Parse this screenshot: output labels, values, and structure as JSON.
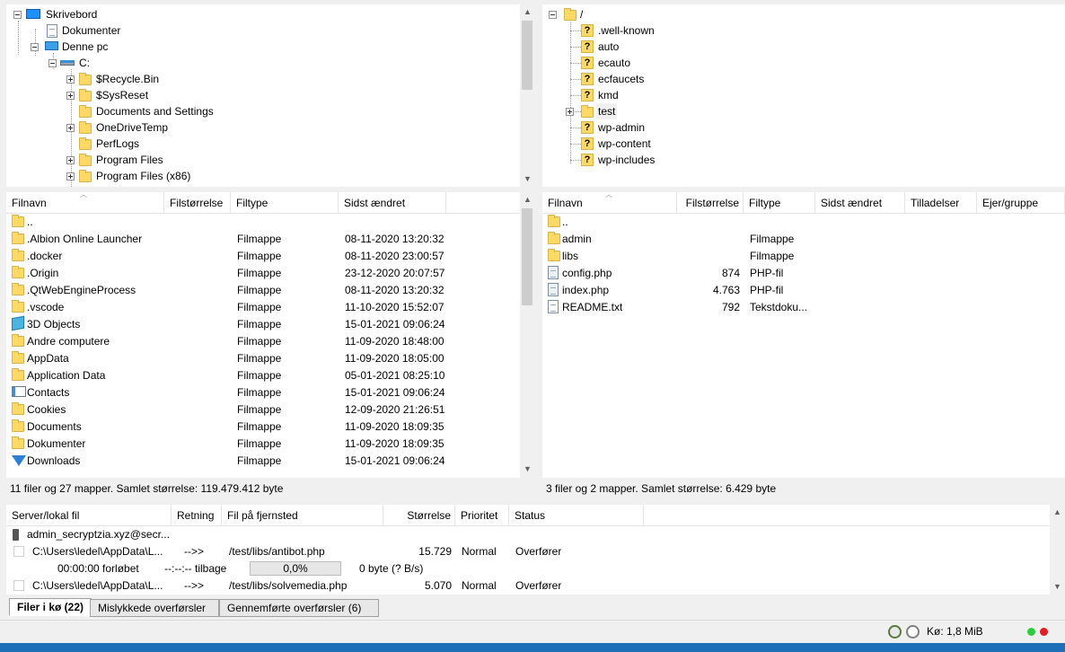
{
  "local_tree": {
    "items": [
      {
        "label": "Skrivebord",
        "icon": "desktop-icon"
      },
      {
        "label": "Dokumenter",
        "icon": "document-icon"
      },
      {
        "label": "Denne pc",
        "icon": "computer-icon"
      },
      {
        "label": "C:",
        "icon": "drive-icon"
      },
      {
        "label": "$Recycle.Bin",
        "icon": "folder-icon"
      },
      {
        "label": "$SysReset",
        "icon": "folder-icon"
      },
      {
        "label": "Documents and Settings",
        "icon": "folder-icon"
      },
      {
        "label": "OneDriveTemp",
        "icon": "folder-icon"
      },
      {
        "label": "PerfLogs",
        "icon": "folder-icon"
      },
      {
        "label": "Program Files",
        "icon": "folder-icon"
      },
      {
        "label": "Program Files (x86)",
        "icon": "folder-icon"
      }
    ]
  },
  "remote_tree": {
    "items": [
      {
        "label": "/",
        "icon": "folder-icon"
      },
      {
        "label": ".well-known",
        "icon": "unknown-folder-icon"
      },
      {
        "label": "auto",
        "icon": "unknown-folder-icon"
      },
      {
        "label": "ecauto",
        "icon": "unknown-folder-icon"
      },
      {
        "label": "ecfaucets",
        "icon": "unknown-folder-icon"
      },
      {
        "label": "kmd",
        "icon": "unknown-folder-icon"
      },
      {
        "label": "test",
        "icon": "folder-icon"
      },
      {
        "label": "wp-admin",
        "icon": "unknown-folder-icon"
      },
      {
        "label": "wp-content",
        "icon": "unknown-folder-icon"
      },
      {
        "label": "wp-includes",
        "icon": "unknown-folder-icon"
      }
    ]
  },
  "local_list": {
    "columns": [
      "Filnavn",
      "Filstørrelse",
      "Filtype",
      "Sidst ændret"
    ],
    "rows": [
      {
        "name": "..",
        "size": "",
        "type": "",
        "modified": "",
        "icon": "folder-icon"
      },
      {
        "name": ".Albion Online Launcher",
        "size": "",
        "type": "Filmappe",
        "modified": "08-11-2020 13:20:32",
        "icon": "folder-icon"
      },
      {
        "name": ".docker",
        "size": "",
        "type": "Filmappe",
        "modified": "08-11-2020 23:00:57",
        "icon": "folder-icon"
      },
      {
        "name": ".Origin",
        "size": "",
        "type": "Filmappe",
        "modified": "23-12-2020 20:07:57",
        "icon": "folder-icon"
      },
      {
        "name": ".QtWebEngineProcess",
        "size": "",
        "type": "Filmappe",
        "modified": "08-11-2020 13:20:32",
        "icon": "folder-icon"
      },
      {
        "name": ".vscode",
        "size": "",
        "type": "Filmappe",
        "modified": "11-10-2020 15:52:07",
        "icon": "folder-icon"
      },
      {
        "name": "3D Objects",
        "size": "",
        "type": "Filmappe",
        "modified": "15-01-2021 09:06:24",
        "icon": "3d-objects-icon"
      },
      {
        "name": "Andre computere",
        "size": "",
        "type": "Filmappe",
        "modified": "11-09-2020 18:48:00",
        "icon": "folder-icon"
      },
      {
        "name": "AppData",
        "size": "",
        "type": "Filmappe",
        "modified": "11-09-2020 18:05:00",
        "icon": "folder-icon"
      },
      {
        "name": "Application Data",
        "size": "",
        "type": "Filmappe",
        "modified": "05-01-2021 08:25:10",
        "icon": "folder-icon"
      },
      {
        "name": "Contacts",
        "size": "",
        "type": "Filmappe",
        "modified": "15-01-2021 09:06:24",
        "icon": "contacts-icon"
      },
      {
        "name": "Cookies",
        "size": "",
        "type": "Filmappe",
        "modified": "12-09-2020 21:26:51",
        "icon": "folder-icon"
      },
      {
        "name": "Documents",
        "size": "",
        "type": "Filmappe",
        "modified": "11-09-2020 18:09:35",
        "icon": "folder-icon"
      },
      {
        "name": "Dokumenter",
        "size": "",
        "type": "Filmappe",
        "modified": "11-09-2020 18:09:35",
        "icon": "folder-icon"
      },
      {
        "name": "Downloads",
        "size": "",
        "type": "Filmappe",
        "modified": "15-01-2021 09:06:24",
        "icon": "downloads-icon"
      }
    ],
    "status": "11 filer og 27 mapper. Samlet størrelse: 119.479.412 byte"
  },
  "remote_list": {
    "columns": [
      "Filnavn",
      "Filstørrelse",
      "Filtype",
      "Sidst ændret",
      "Tilladelser",
      "Ejer/gruppe"
    ],
    "rows": [
      {
        "name": "..",
        "size": "",
        "type": "",
        "icon": "folder-icon"
      },
      {
        "name": "admin",
        "size": "",
        "type": "Filmappe",
        "icon": "folder-icon"
      },
      {
        "name": "libs",
        "size": "",
        "type": "Filmappe",
        "icon": "folder-icon"
      },
      {
        "name": "config.php",
        "size": "874",
        "type": "PHP-fil",
        "icon": "php-file-icon"
      },
      {
        "name": "index.php",
        "size": "4.763",
        "type": "PHP-fil",
        "icon": "php-file-icon"
      },
      {
        "name": "README.txt",
        "size": "792",
        "type": "Tekstdoku...",
        "icon": "text-file-icon"
      }
    ],
    "status": "3 filer og 2 mapper. Samlet størrelse: 6.429 byte"
  },
  "queue": {
    "columns": [
      "Server/lokal fil",
      "Retning",
      "Fil på fjernsted",
      "Størrelse",
      "Prioritet",
      "Status"
    ],
    "server": "admin_secryptzia.xyz@secr...",
    "items": [
      {
        "local": "C:\\Users\\ledel\\AppData\\L...",
        "direction": "-->>",
        "remote": "/test/libs/antibot.php",
        "size": "15.729",
        "priority": "Normal",
        "status": "Overfører"
      },
      {
        "local": "C:\\Users\\ledel\\AppData\\L...",
        "direction": "-->>",
        "remote": "/test/libs/solvemedia.php",
        "size": "5.070",
        "priority": "Normal",
        "status": "Overfører"
      }
    ],
    "progress": {
      "elapsed": "00:00:00 forløbet",
      "remaining": "--:--:-- tilbage",
      "percent_label": "0,0%",
      "percent": 0,
      "rate": "0 byte (? B/s)"
    }
  },
  "tabs": [
    {
      "label": "Filer i kø (22)",
      "active": true
    },
    {
      "label": "Mislykkede overførsler",
      "active": false
    },
    {
      "label": "Gennemførte overførsler (6)",
      "active": false
    }
  ],
  "statusbar": {
    "queue": "Kø: 1,8 MiB"
  },
  "colors": {
    "folder": "#ffd966",
    "led_green": "#2ecc40",
    "led_red": "#e02020"
  }
}
